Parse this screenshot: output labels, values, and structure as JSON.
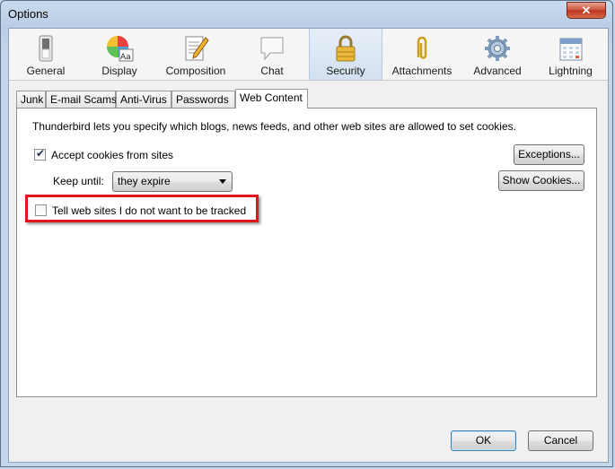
{
  "window": {
    "title": "Options",
    "close_symbol": "✕"
  },
  "panes": [
    {
      "label": "General",
      "icon": "switch-icon"
    },
    {
      "label": "Display",
      "icon": "color-wheel-icon"
    },
    {
      "label": "Composition",
      "icon": "document-pencil-icon"
    },
    {
      "label": "Chat",
      "icon": "speech-bubble-icon"
    },
    {
      "label": "Security",
      "icon": "padlock-icon",
      "selected": true
    },
    {
      "label": "Attachments",
      "icon": "paperclip-icon"
    },
    {
      "label": "Advanced",
      "icon": "gear-icon"
    },
    {
      "label": "Lightning",
      "icon": "calendar-icon"
    }
  ],
  "tabs": [
    {
      "label": "Junk"
    },
    {
      "label": "E-mail Scams"
    },
    {
      "label": "Anti-Virus"
    },
    {
      "label": "Passwords"
    },
    {
      "label": "Web Content",
      "active": true
    }
  ],
  "web_content": {
    "description": "Thunderbird lets you specify which blogs, news feeds, and other web sites are allowed to set cookies.",
    "accept_cookies": {
      "label": "Accept cookies from sites",
      "checked": true
    },
    "keep_until": {
      "label": "Keep until:",
      "value": "they expire"
    },
    "exceptions_button": "Exceptions...",
    "show_cookies_button": "Show Cookies...",
    "do_not_track": {
      "label": "Tell web sites I do not want to be tracked",
      "checked": false
    }
  },
  "footer": {
    "ok_label": "OK",
    "cancel_label": "Cancel"
  },
  "colors": {
    "highlight": "#e2161a",
    "titlebar": "#c4d6ea",
    "close": "#c9503a"
  }
}
